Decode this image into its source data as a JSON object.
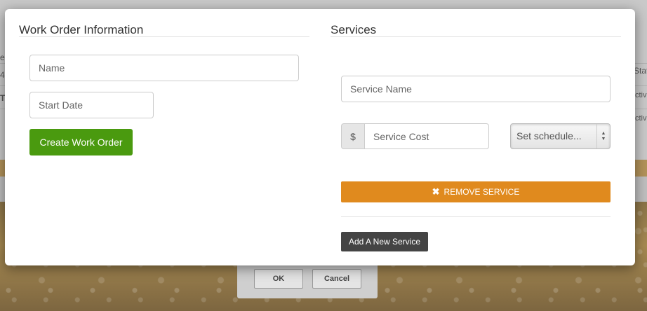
{
  "background": {
    "dialog": {
      "ok_label": "OK",
      "cancel_label": "Cancel"
    },
    "right_fragments": [
      "Stat",
      "ctiv",
      "ctiv"
    ],
    "left_fragments": [
      "e",
      "4",
      "T"
    ]
  },
  "work_order": {
    "title": "Work Order Information",
    "name_placeholder": "Name",
    "start_date_placeholder": "Start Date",
    "create_button": "Create Work Order"
  },
  "services": {
    "title": "Services",
    "service_name_placeholder": "Service Name",
    "currency_symbol": "$",
    "service_cost_placeholder": "Service Cost",
    "schedule_select": {
      "selected": "Set schedule..."
    },
    "remove_button": "REMOVE SERVICE",
    "add_button": "Add A New Service"
  },
  "colors": {
    "create_button": "#4a9a0f",
    "remove_button": "#e08a1e",
    "add_button": "#444444"
  }
}
